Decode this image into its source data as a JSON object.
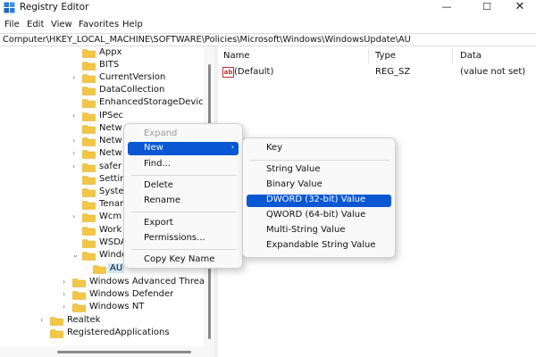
{
  "window": {
    "title": "Registry Editor",
    "minimize_glyph": "—",
    "maximize_glyph": "☐",
    "close_glyph": "✕"
  },
  "menubar": {
    "file": "File",
    "edit": "Edit",
    "view": "View",
    "favorites": "Favorites",
    "help": "Help"
  },
  "address": {
    "path": "Computer\\HKEY_LOCAL_MACHINE\\SOFTWARE\\Policies\\Microsoft\\Windows\\WindowsUpdate\\AU"
  },
  "tree": {
    "items": [
      {
        "label": "Appx",
        "expander": ""
      },
      {
        "label": "BITS",
        "expander": ""
      },
      {
        "label": "CurrentVersion",
        "expander": "›"
      },
      {
        "label": "DataCollection",
        "expander": ""
      },
      {
        "label": "EnhancedStorageDevices",
        "expander": ""
      },
      {
        "label": "IPSec",
        "expander": "›"
      },
      {
        "label": "Netw",
        "expander": ""
      },
      {
        "label": "Netw",
        "expander": "›"
      },
      {
        "label": "Netw",
        "expander": "›"
      },
      {
        "label": "safer",
        "expander": "›"
      },
      {
        "label": "Settin",
        "expander": ""
      },
      {
        "label": "Syste",
        "expander": ""
      },
      {
        "label": "Tenar",
        "expander": ""
      },
      {
        "label": "Wcm",
        "expander": "›"
      },
      {
        "label": "Work",
        "expander": ""
      },
      {
        "label": "WSDA",
        "expander": ""
      },
      {
        "label": "Windo",
        "expander": "⌄"
      },
      {
        "label": "AU",
        "expander": ""
      },
      {
        "label": "Windows Advanced Threat Prot",
        "expander": "›"
      },
      {
        "label": "Windows Defender",
        "expander": "›"
      },
      {
        "label": "Windows NT",
        "expander": "›"
      },
      {
        "label": "Realtek",
        "expander": "›"
      },
      {
        "label": "RegisteredApplications",
        "expander": ""
      }
    ],
    "selected_label": "AU"
  },
  "values": {
    "headers": {
      "name": "Name",
      "type": "Type",
      "data": "Data"
    },
    "rows": [
      {
        "name": "(Default)",
        "type": "REG_SZ",
        "data": "(value not set)",
        "icon_text": "ab"
      }
    ]
  },
  "context_menu": {
    "expand": "Expand",
    "new": "New",
    "new_arrow": "›",
    "find": "Find...",
    "delete": "Delete",
    "rename": "Rename",
    "export": "Export",
    "permissions": "Permissions...",
    "copy_key_name": "Copy Key Name"
  },
  "new_submenu": {
    "key": "Key",
    "string_value": "String Value",
    "binary_value": "Binary Value",
    "dword_value": "DWORD (32-bit) Value",
    "qword_value": "QWORD (64-bit) Value",
    "multi_string_value": "Multi-String Value",
    "expandable_string_value": "Expandable String Value",
    "highlighted": "DWORD (32-bit) Value"
  },
  "colors": {
    "highlight": "#0a57d4",
    "selection": "#cce4f7",
    "folder": "#f2c744",
    "folder_dark": "#dca92b"
  },
  "icons": {
    "app": "registry-cube-icon",
    "folder": "folder-icon",
    "string_value": "ab-string-value-icon"
  }
}
